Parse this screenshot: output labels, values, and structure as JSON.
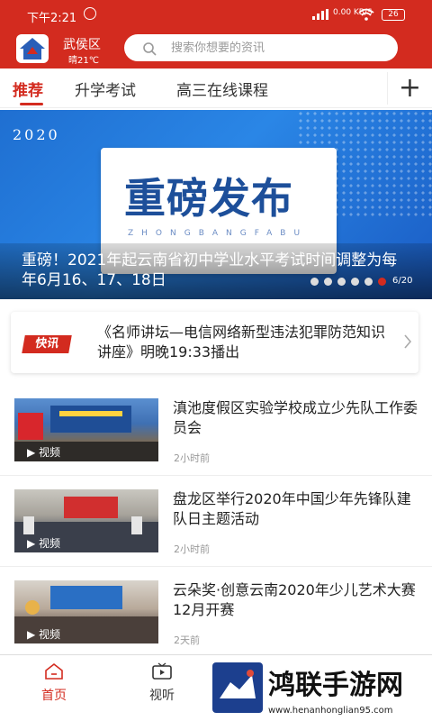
{
  "status_bar": {
    "time": "下午2:21",
    "network": "0.00 KB/S",
    "battery": "26"
  },
  "header": {
    "location": "武侯区",
    "weather": "晴21℃",
    "search_placeholder": "搜索你想要的资讯"
  },
  "tabs": [
    {
      "label": "推荐",
      "active": true
    },
    {
      "label": "升学考试",
      "active": false
    },
    {
      "label": "高三在线课程",
      "active": false
    }
  ],
  "banner": {
    "year": "2020",
    "headline": "重磅发布",
    "pinyin": "ZHONGBANGFABU",
    "caption": "重磅！2021年起云南省初中学业水平考试时间调整为每年6月16、17、18日",
    "pager": "6/20"
  },
  "kuaixun": {
    "badge": "快讯",
    "text": "《名师讲坛—电信网络新型违法犯罪防范知识讲座》明晚19:33播出"
  },
  "news": [
    {
      "title": "滇池度假区实验学校成立少先队工作委员会",
      "time": "2小时前",
      "tag": "视频"
    },
    {
      "title": "盘龙区举行2020年中国少年先锋队建队日主题活动",
      "time": "2小时前",
      "tag": "视频"
    },
    {
      "title": "云朵奖·创意云南2020年少儿艺术大赛12月开赛",
      "time": "2天前",
      "tag": "视频"
    }
  ],
  "bottom_nav": [
    {
      "label": "首页",
      "icon": "home-icon",
      "active": true
    },
    {
      "label": "视听",
      "icon": "tv-icon",
      "active": false
    }
  ],
  "watermark": {
    "title": "鸿联手游网",
    "url": "www.henanhonglian95.com"
  },
  "colors": {
    "brand": "#d32b1f",
    "banner_blue": "#2a86e6"
  }
}
